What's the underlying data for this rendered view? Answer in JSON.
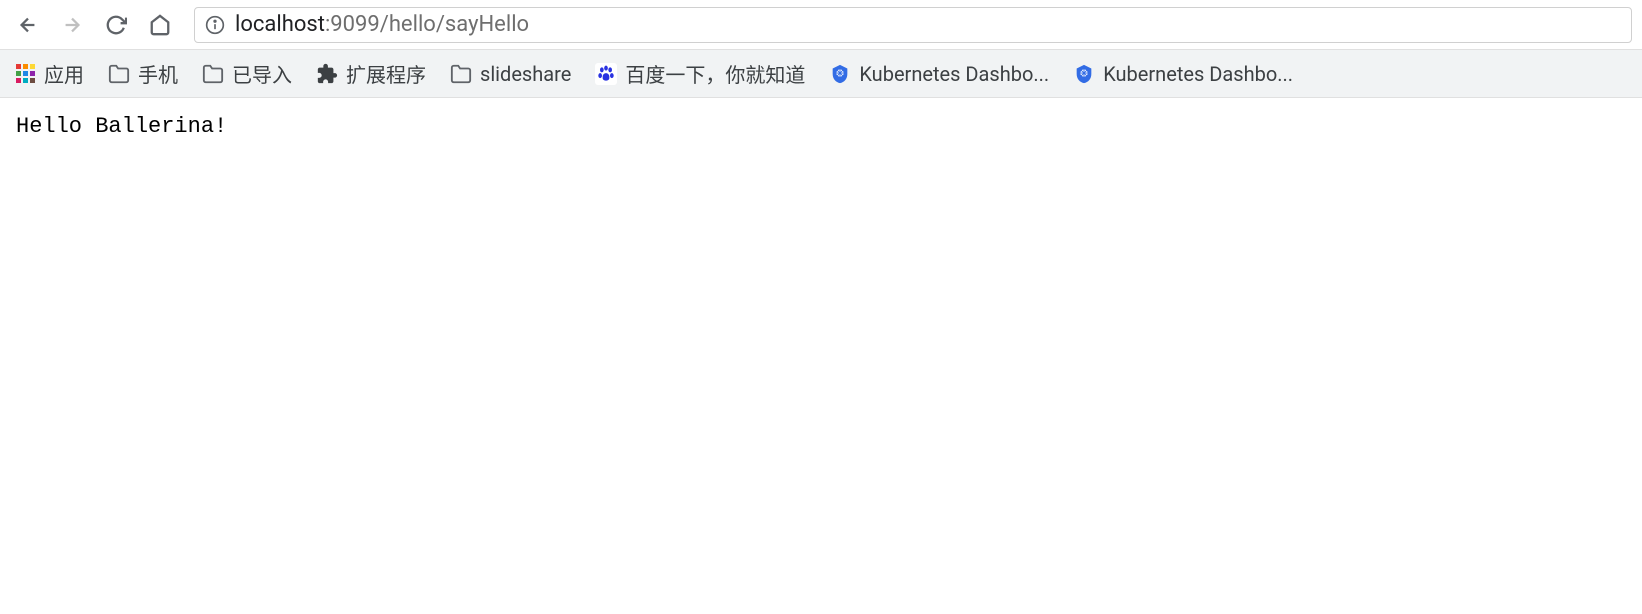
{
  "toolbar": {
    "url_host": "localhost",
    "url_port_path": ":9099/hello/sayHello"
  },
  "bookmarks": {
    "items": [
      {
        "label": "应用",
        "icon": "apps"
      },
      {
        "label": "手机",
        "icon": "folder"
      },
      {
        "label": "已导入",
        "icon": "folder"
      },
      {
        "label": "扩展程序",
        "icon": "extension"
      },
      {
        "label": "slideshare",
        "icon": "folder"
      },
      {
        "label": "百度一下，你就知道",
        "icon": "baidu"
      },
      {
        "label": "Kubernetes Dashbo...",
        "icon": "kubernetes"
      },
      {
        "label": "Kubernetes Dashbo...",
        "icon": "kubernetes"
      }
    ]
  },
  "page": {
    "body_text": "Hello Ballerina!"
  }
}
